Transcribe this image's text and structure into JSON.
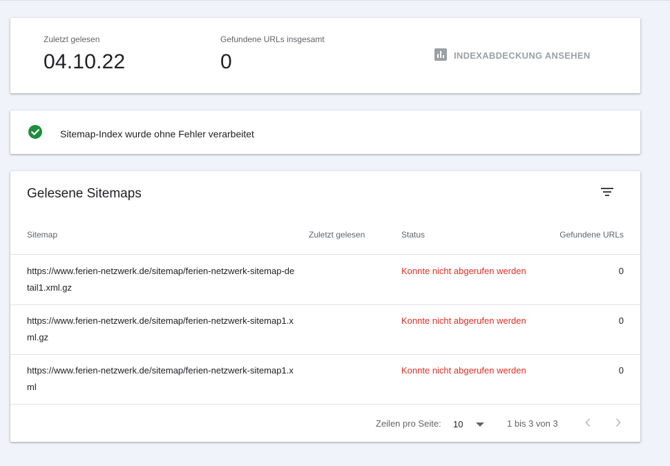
{
  "summary": {
    "last_read_label": "Zuletzt gelesen",
    "last_read_value": "04.10.22",
    "found_urls_label": "Gefundene URLs insgesamt",
    "found_urls_value": "0",
    "coverage_link": "INDEXABDECKUNG ANSEHEN"
  },
  "status_message": "Sitemap-Index wurde ohne Fehler verarbeitet",
  "table": {
    "title": "Gelesene Sitemaps",
    "columns": {
      "sitemap": "Sitemap",
      "last_read": "Zuletzt gelesen",
      "status": "Status",
      "found_urls": "Gefundene URLs"
    },
    "rows": [
      {
        "sitemap": "https://www.ferien-netzwerk.de/sitemap/ferien-netzwerk-sitemap-detail1.xml.gz",
        "last_read": "",
        "status": "Konnte nicht abgerufen werden",
        "found_urls": "0"
      },
      {
        "sitemap": "https://www.ferien-netzwerk.de/sitemap/ferien-netzwerk-sitemap1.xml.gz",
        "last_read": "",
        "status": "Konnte nicht abgerufen werden",
        "found_urls": "0"
      },
      {
        "sitemap": "https://www.ferien-netzwerk.de/sitemap/ferien-netzwerk-sitemap1.xml",
        "last_read": "",
        "status": "Konnte nicht abgerufen werden",
        "found_urls": "0"
      }
    ],
    "footer": {
      "rows_per_page_label": "Zeilen pro Seite:",
      "rows_per_page_value": "10",
      "range": "1 bis 3 von 3"
    }
  },
  "icons": {
    "coverage": "bar-chart-icon",
    "status": "check-circle-icon",
    "filter": "filter-icon",
    "dropdown": "caret-down-icon",
    "prev": "chevron-left-icon",
    "next": "chevron-right-icon"
  },
  "colors": {
    "success": "#1e8e3e",
    "error": "#d93025",
    "muted": "#9aa0a6",
    "background": "#f1f3fa"
  }
}
